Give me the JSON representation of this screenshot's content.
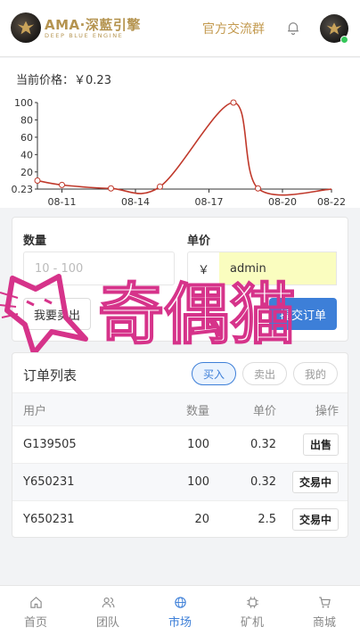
{
  "header": {
    "brand_name": "AMA·深藍引擎",
    "brand_sub": "DEEP BLUE ENGINE",
    "group_link": "官方交流群"
  },
  "price": {
    "label": "当前价格：",
    "value": "￥0.23"
  },
  "chart_data": {
    "type": "line",
    "x": [
      "08-10",
      "08-11",
      "08-13",
      "08-15",
      "08-18",
      "08-19",
      "08-22"
    ],
    "values": [
      10,
      5,
      1,
      3,
      100,
      1,
      0
    ],
    "x_tick_labels": [
      "08-11",
      "08-14",
      "08-17",
      "08-20",
      "08-22"
    ],
    "y_tick_labels": [
      "100",
      "80",
      "60",
      "40",
      "20",
      "0.23"
    ],
    "ylim": [
      0.23,
      100
    ],
    "color": "#c0392b",
    "grid": false
  },
  "trade": {
    "qty_label": "数量",
    "price_label": "单价",
    "qty_placeholder": "10 - 100",
    "currency": "￥",
    "price_value": "admin",
    "sell_label": "我要卖出",
    "post_label": "提交订单"
  },
  "orders": {
    "title": "订单列表",
    "tabs": [
      "买入",
      "卖出",
      "我的"
    ],
    "columns": [
      "用户",
      "数量",
      "单价",
      "操作"
    ],
    "rows": [
      {
        "user": "G139505",
        "qty": "100",
        "price": "0.32",
        "action": "出售"
      },
      {
        "user": "Y650231",
        "qty": "100",
        "price": "0.32",
        "action": "交易中"
      },
      {
        "user": "Y650231",
        "qty": "20",
        "price": "2.5",
        "action": "交易中"
      }
    ]
  },
  "nav": {
    "items": [
      {
        "label": "首页",
        "icon": "home-icon"
      },
      {
        "label": "团队",
        "icon": "team-icon"
      },
      {
        "label": "市场",
        "icon": "globe-icon"
      },
      {
        "label": "矿机",
        "icon": "chip-icon"
      },
      {
        "label": "商城",
        "icon": "cart-icon"
      }
    ],
    "active_index": 2
  },
  "watermark": {
    "text": "奇偶猫"
  },
  "colors": {
    "accent": "#3d7fd8",
    "brand_gold": "#c39a4f",
    "chart_line": "#c0392b",
    "watermark": "#d6338a"
  }
}
